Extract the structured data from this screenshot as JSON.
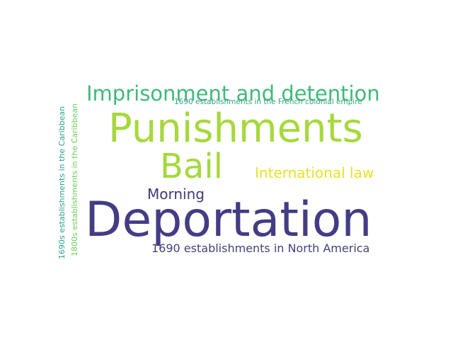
{
  "words": {
    "imprisonment": {
      "text": "Imprisonment and detention",
      "color": "#3fb97a"
    },
    "french": {
      "text": "1690 establishments in the French colonial empire",
      "color": "#35a47f"
    },
    "punishments": {
      "text": "Punishments",
      "color": "#a6d93b"
    },
    "bail": {
      "text": "Bail",
      "color": "#a3d93c"
    },
    "intl": {
      "text": "International law",
      "color": "#e8e125"
    },
    "morning": {
      "text": "Morning",
      "color": "#453779"
    },
    "deportation": {
      "text": "Deportation",
      "color": "#433d84"
    },
    "north_america": {
      "text": "1690 establishments in North America",
      "color": "#41427f"
    },
    "caribbean_1690s": {
      "text": "1690s establishments in the Caribbean",
      "color": "#2ea38a"
    },
    "caribbean_1800s": {
      "text": "1800s establishments in the Caribbean",
      "color": "#6dcd59"
    }
  }
}
